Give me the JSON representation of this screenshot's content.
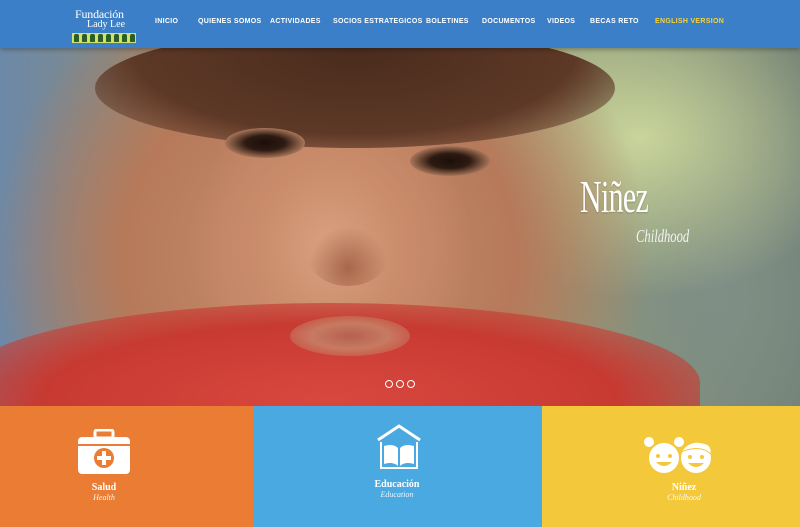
{
  "header": {
    "logo": {
      "line1": "Fundación",
      "line2": "Lady Lee"
    },
    "nav": [
      {
        "label": "INICIO"
      },
      {
        "label": "QUIENES SOMOS"
      },
      {
        "label": "ACTIVIDADES"
      },
      {
        "label": "SOCIOS ESTRATEGICOS"
      },
      {
        "label": "BOLETINES"
      },
      {
        "label": "DOCUMENTOS"
      },
      {
        "label": "VIDEOS"
      },
      {
        "label": "BECAS RETO"
      },
      {
        "label": "ENGLISH VERSION"
      }
    ]
  },
  "hero": {
    "title": "Niñez",
    "subtitle": "Childhood",
    "slides": 3
  },
  "tiles": [
    {
      "label": "Salud",
      "sub": "Health",
      "icon": "medical-kit-icon",
      "color": "#ea7d33"
    },
    {
      "label": "Educación",
      "sub": "Education",
      "icon": "open-book-icon",
      "color": "#4aa9e0"
    },
    {
      "label": "Niñez",
      "sub": "Childhood",
      "icon": "children-faces-icon",
      "color": "#f3c83b"
    }
  ],
  "colors": {
    "header": "#3b7fc8",
    "english_link": "#f4d23c"
  }
}
